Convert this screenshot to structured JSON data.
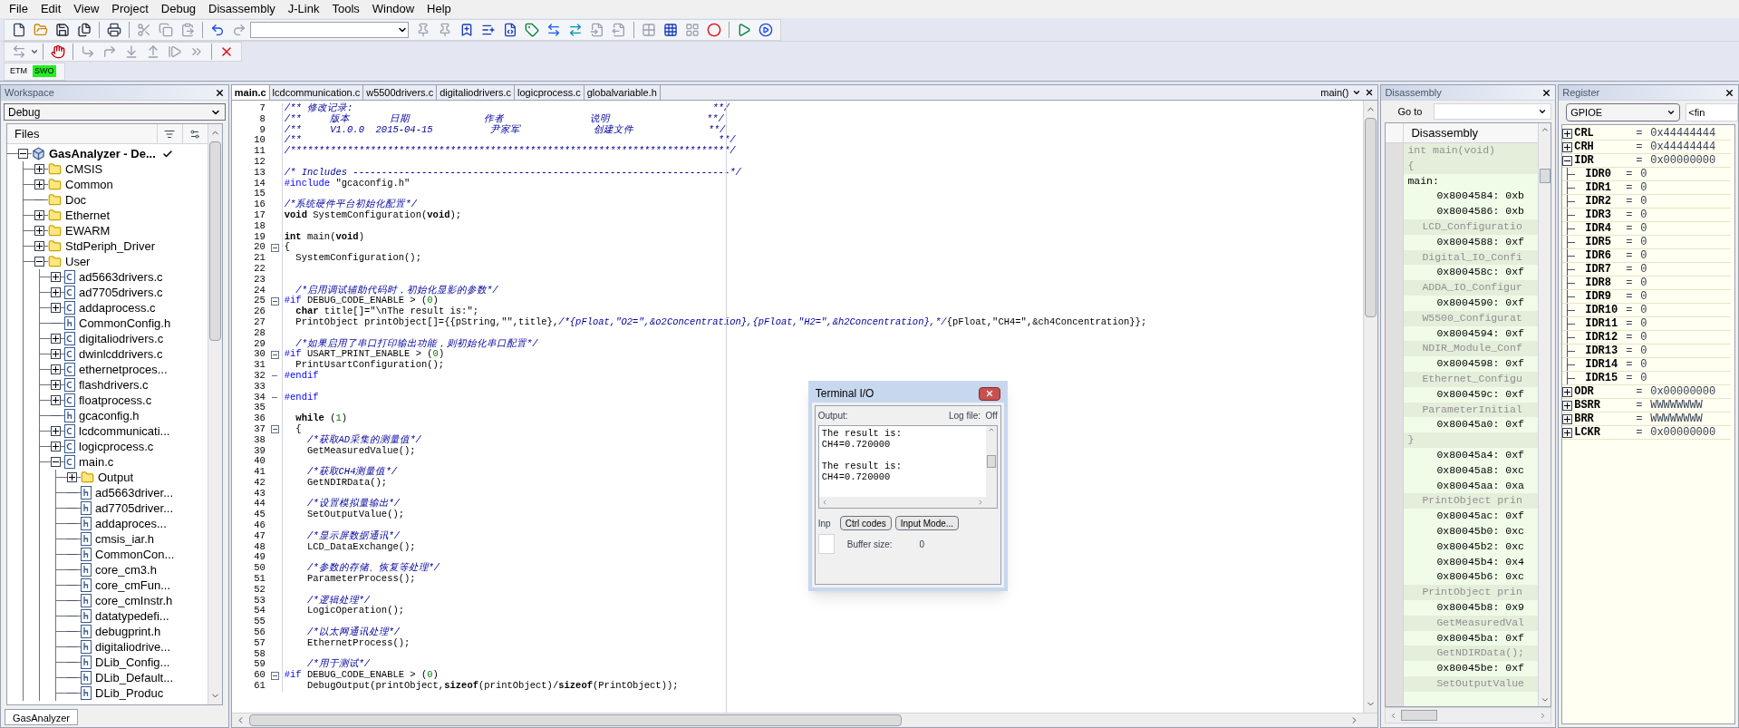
{
  "menu": [
    {
      "label": "File"
    },
    {
      "label": "Edit"
    },
    {
      "label": "View"
    },
    {
      "label": "Project"
    },
    {
      "label": "Debug"
    },
    {
      "label": "Disassembly"
    },
    {
      "label": "J-Link"
    },
    {
      "label": "Tools"
    },
    {
      "label": "Window"
    },
    {
      "label": "Help"
    }
  ],
  "toolbars": {
    "main": [
      {
        "disabled": false
      },
      {
        "disabled": false
      },
      {
        "disabled": false
      },
      {
        "disabled": false
      },
      {
        "disabled": false
      },
      {
        "disabled": true
      },
      {
        "disabled": true
      },
      {
        "disabled": true
      },
      {
        "disabled": false
      },
      {
        "disabled": true
      },
      {
        "disabled": true
      },
      {
        "disabled": true
      },
      {
        "disabled": false
      },
      {
        "disabled": false
      },
      {
        "disabled": false
      },
      {
        "disabled": false
      },
      {
        "disabled": false
      },
      {
        "disabled": false
      },
      {
        "disabled": true
      },
      {
        "disabled": true
      },
      {
        "disabled": true
      },
      {
        "disabled": false
      },
      {
        "disabled": true
      },
      {
        "disabled": false
      },
      {
        "disabled": false
      },
      {
        "disabled": false
      }
    ],
    "debug": [
      {
        "disabled": true
      },
      {
        "disabled": false
      },
      {
        "disabled": true
      },
      {
        "disabled": true
      },
      {
        "disabled": true
      },
      {
        "disabled": true
      },
      {
        "disabled": true
      },
      {
        "disabled": true
      },
      {
        "disabled": false
      }
    ],
    "trace": [
      {
        "label": "ETM",
        "on": false
      },
      {
        "label": "SWO",
        "on": true
      }
    ]
  },
  "workspace": {
    "title": "Workspace",
    "config": "Debug",
    "files_header": "Files",
    "bottom_tab": "GasAnalyzer",
    "tree": [
      {
        "label": "GasAnalyzer - De...",
        "kind": "project",
        "expanded": true,
        "checked": true,
        "children": [
          {
            "label": "CMSIS",
            "kind": "folder",
            "expanded": false
          },
          {
            "label": "Common",
            "kind": "folder",
            "expanded": false
          },
          {
            "label": "Doc",
            "kind": "folder"
          },
          {
            "label": "Ethernet",
            "kind": "folder",
            "expanded": false
          },
          {
            "label": "EWARM",
            "kind": "folder",
            "expanded": false
          },
          {
            "label": "StdPeriph_Driver",
            "kind": "folder",
            "expanded": false
          },
          {
            "label": "User",
            "kind": "folder",
            "expanded": true,
            "children": [
              {
                "label": "ad5663drivers.c",
                "kind": "c",
                "expanded": false
              },
              {
                "label": "ad7705drivers.c",
                "kind": "c",
                "expanded": false
              },
              {
                "label": "addaprocess.c",
                "kind": "c",
                "expanded": false
              },
              {
                "label": "CommonConfig.h",
                "kind": "h"
              },
              {
                "label": "digitaliodrivers.c",
                "kind": "c",
                "expanded": false
              },
              {
                "label": "dwinlcddrivers.c",
                "kind": "c",
                "expanded": false
              },
              {
                "label": "ethernetproces...",
                "kind": "c",
                "expanded": false
              },
              {
                "label": "flashdrivers.c",
                "kind": "c",
                "expanded": false
              },
              {
                "label": "floatprocess.c",
                "kind": "c",
                "expanded": false
              },
              {
                "label": "gcaconfig.h",
                "kind": "h"
              },
              {
                "label": "lcdcommunicati...",
                "kind": "c",
                "expanded": false
              },
              {
                "label": "logicprocess.c",
                "kind": "c",
                "expanded": false
              },
              {
                "label": "main.c",
                "kind": "c",
                "expanded": true,
                "children": [
                  {
                    "label": "Output",
                    "kind": "folder",
                    "expanded": false
                  },
                  {
                    "label": "ad5663driver...",
                    "kind": "h"
                  },
                  {
                    "label": "ad7705driver...",
                    "kind": "h"
                  },
                  {
                    "label": "addaproces...",
                    "kind": "h"
                  },
                  {
                    "label": "cmsis_iar.h",
                    "kind": "h"
                  },
                  {
                    "label": "CommonCon...",
                    "kind": "h"
                  },
                  {
                    "label": "core_cm3.h",
                    "kind": "h"
                  },
                  {
                    "label": "core_cmFun...",
                    "kind": "h"
                  },
                  {
                    "label": "core_cmInstr.h",
                    "kind": "h"
                  },
                  {
                    "label": "datatypedefi...",
                    "kind": "h"
                  },
                  {
                    "label": "debugprint.h",
                    "kind": "h"
                  },
                  {
                    "label": "digitaliodrive...",
                    "kind": "h"
                  },
                  {
                    "label": "DLib_Config...",
                    "kind": "h"
                  },
                  {
                    "label": "DLib_Default...",
                    "kind": "h"
                  },
                  {
                    "label": "DLib_Produc",
                    "kind": "h"
                  }
                ]
              }
            ]
          }
        ]
      }
    ]
  },
  "editor": {
    "tabs": [
      {
        "label": "main.c",
        "selected": true
      },
      {
        "label": "lcdcommunication.c",
        "selected": false
      },
      {
        "label": "w5500drivers.c",
        "selected": false
      },
      {
        "label": "digitaliodrivers.c",
        "selected": false
      },
      {
        "label": "logicprocess.c",
        "selected": false
      },
      {
        "label": "globalvariable.h",
        "selected": false
      }
    ],
    "function": "main()",
    "lines": [
      {
        "n": "7",
        "segs": [
          {
            "kind": "comment",
            "text": "/** 修改记录:                                                               **/"
          }
        ]
      },
      {
        "n": "8",
        "segs": [
          {
            "kind": "comment",
            "text": "/**     版本       日期             作者               说明                 **/"
          }
        ]
      },
      {
        "n": "9",
        "segs": [
          {
            "kind": "comment",
            "text": "/**     V1.0.0  2015-04-15          尹家军             创建文件             **/"
          }
        ]
      },
      {
        "n": "10",
        "segs": [
          {
            "kind": "comment",
            "text": "/**                                                                         **/"
          }
        ]
      },
      {
        "n": "11",
        "segs": [
          {
            "kind": "comment",
            "text": "/*****************************************************************************/"
          }
        ]
      },
      {
        "n": "12"
      },
      {
        "n": "13",
        "segs": [
          {
            "kind": "comment",
            "text": "/* Includes ------------------------------------------------------------------*/"
          }
        ]
      },
      {
        "n": "14",
        "segs": [
          {
            "kind": "pre",
            "text": "#include "
          },
          {
            "kind": "code",
            "text": "\"gcaconfig.h\""
          }
        ]
      },
      {
        "n": "15"
      },
      {
        "n": "16",
        "segs": [
          {
            "kind": "comment",
            "text": "/*系统硬件平台初始化配置*/"
          }
        ]
      },
      {
        "n": "17",
        "segs": [
          {
            "kind": "code",
            "text": "**void** SystemConfiguration(**void**);"
          }
        ]
      },
      {
        "n": "18"
      },
      {
        "n": "19",
        "segs": [
          {
            "kind": "code",
            "text": "**int** main(**void**)"
          }
        ]
      },
      {
        "n": "20",
        "collapsible": true,
        "segs": [
          {
            "kind": "code",
            "text": "{"
          }
        ]
      },
      {
        "n": "21",
        "segs": [
          {
            "kind": "code",
            "text": "  SystemConfiguration();"
          }
        ]
      },
      {
        "n": "22"
      },
      {
        "n": "23"
      },
      {
        "n": "24",
        "segs": [
          {
            "kind": "comment",
            "text": "  /*启用调试辅助代码时，初始化显影的参数*/"
          }
        ]
      },
      {
        "n": "25",
        "collapsible": true,
        "segs": [
          {
            "kind": "pre",
            "text": "#if"
          },
          {
            "kind": "code",
            "text": " DEBUG_CODE_ENABLE > ("
          },
          {
            "kind": "number",
            "text": "0"
          },
          {
            "kind": "code",
            "text": ")"
          }
        ]
      },
      {
        "n": "26",
        "segs": [
          {
            "kind": "code",
            "text": "  **char** title[]=\"\\nThe result is:\";"
          }
        ]
      },
      {
        "n": "27",
        "segs": [
          {
            "kind": "code",
            "text": "  PrintObject printObject[]={{pString,\"\",title},"
          },
          {
            "kind": "comment",
            "text": "/*{pFloat,\"O2=\",&o2Concentration},{pFloat,\"H2=\",&h2Concentration},*/"
          },
          {
            "kind": "code",
            "text": "{pFloat,\"CH4=\",&ch4Concentration}};"
          }
        ]
      },
      {
        "n": "28"
      },
      {
        "n": "29",
        "segs": [
          {
            "kind": "comment",
            "text": "  /*如果启用了串口打印输出功能，则初始化串口配置*/"
          }
        ]
      },
      {
        "n": "30",
        "collapsible": true,
        "segs": [
          {
            "kind": "pre",
            "text": "#if"
          },
          {
            "kind": "code",
            "text": " USART_PRINT_ENABLE > ("
          },
          {
            "kind": "number",
            "text": "0"
          },
          {
            "kind": "code",
            "text": ")"
          }
        ]
      },
      {
        "n": "31",
        "segs": [
          {
            "kind": "code",
            "text": "  PrintUsartConfiguration();"
          }
        ]
      },
      {
        "n": "32",
        "block_end": true,
        "segs": [
          {
            "kind": "pre",
            "text": "#endif"
          }
        ]
      },
      {
        "n": "33"
      },
      {
        "n": "34",
        "block_end": true,
        "segs": [
          {
            "kind": "pre",
            "text": "#endif"
          }
        ]
      },
      {
        "n": "35"
      },
      {
        "n": "36",
        "segs": [
          {
            "kind": "code",
            "text": "  **while** ("
          },
          {
            "kind": "number",
            "text": "1"
          },
          {
            "kind": "code",
            "text": ")"
          }
        ]
      },
      {
        "n": "37",
        "collapsible": true,
        "segs": [
          {
            "kind": "code",
            "text": "  {"
          }
        ]
      },
      {
        "n": "38",
        "segs": [
          {
            "kind": "comment",
            "text": "    /*获取AD采集的测量值*/"
          }
        ]
      },
      {
        "n": "39",
        "segs": [
          {
            "kind": "code",
            "text": "    GetMeasuredValue();"
          }
        ]
      },
      {
        "n": "40"
      },
      {
        "n": "41",
        "segs": [
          {
            "kind": "comment",
            "text": "    /*获取CH4测量值*/"
          }
        ]
      },
      {
        "n": "42",
        "segs": [
          {
            "kind": "code",
            "text": "    GetNDIRData();"
          }
        ]
      },
      {
        "n": "43"
      },
      {
        "n": "44",
        "segs": [
          {
            "kind": "comment",
            "text": "    /*设置模拟量输出*/"
          }
        ]
      },
      {
        "n": "45",
        "segs": [
          {
            "kind": "code",
            "text": "    SetOutputValue();"
          }
        ]
      },
      {
        "n": "46"
      },
      {
        "n": "47",
        "segs": [
          {
            "kind": "comment",
            "text": "    /*显示屏数据通讯*/"
          }
        ]
      },
      {
        "n": "48",
        "segs": [
          {
            "kind": "code",
            "text": "    LCD_DataExchange();"
          }
        ]
      },
      {
        "n": "49"
      },
      {
        "n": "50",
        "segs": [
          {
            "kind": "comment",
            "text": "    /*参数的存储、恢复等处理*/"
          }
        ]
      },
      {
        "n": "51",
        "segs": [
          {
            "kind": "code",
            "text": "    ParameterProcess();"
          }
        ]
      },
      {
        "n": "52"
      },
      {
        "n": "53",
        "segs": [
          {
            "kind": "comment",
            "text": "    /*逻辑处理*/"
          }
        ]
      },
      {
        "n": "54",
        "segs": [
          {
            "kind": "code",
            "text": "    LogicOperation();"
          }
        ]
      },
      {
        "n": "55"
      },
      {
        "n": "56",
        "segs": [
          {
            "kind": "comment",
            "text": "    /*以太网通讯处理*/"
          }
        ]
      },
      {
        "n": "57",
        "segs": [
          {
            "kind": "code",
            "text": "    EthernetProcess();"
          }
        ]
      },
      {
        "n": "58"
      },
      {
        "n": "59",
        "segs": [
          {
            "kind": "comment",
            "text": "    /*用于测试*/"
          }
        ]
      },
      {
        "n": "60",
        "collapsible": true,
        "segs": [
          {
            "kind": "pre",
            "text": "#if"
          },
          {
            "kind": "code",
            "text": " DEBUG_CODE_ENABLE > ("
          },
          {
            "kind": "number",
            "text": "0"
          },
          {
            "kind": "code",
            "text": ")"
          }
        ]
      },
      {
        "n": "61",
        "segs": [
          {
            "kind": "code",
            "text": "    DebugOutput(printObject,**sizeof**(printObject)/**sizeof**(PrintObject));"
          }
        ]
      }
    ]
  },
  "terminal": {
    "title": "Terminal I/O",
    "output_label": "Output:",
    "log_file": "Log file:  Off",
    "output": [
      {
        "lines": [
          "The result is:",
          "CH4=0.720000"
        ]
      },
      {
        "lines": [
          "The result is:",
          "CH4=0.720000"
        ]
      }
    ],
    "input_label": "Inp",
    "buttons": [
      "Ctrl codes",
      "Input Mode..."
    ],
    "buffer_label": "Buffer size:",
    "buffer_value": "0"
  },
  "disassembly": {
    "title": "Disassembly",
    "goto_label": "Go to",
    "header": "Disassembly",
    "rows": [
      {
        "kind": "decl",
        "text": "int main(void)"
      },
      {
        "kind": "decl",
        "text": "{"
      },
      {
        "kind": "label",
        "text": "main:"
      },
      {
        "kind": "addr",
        "text": "0x8004584: 0xb"
      },
      {
        "kind": "addr",
        "text": "0x8004586: 0xb"
      },
      {
        "kind": "source",
        "text": "LCD_Configuratio"
      },
      {
        "kind": "addr",
        "text": "0x8004588: 0xf"
      },
      {
        "kind": "source",
        "text": "Digital_IO_Confi"
      },
      {
        "kind": "addr",
        "text": "0x800458c: 0xf"
      },
      {
        "kind": "source",
        "text": "ADDA_IO_Configur"
      },
      {
        "kind": "addr",
        "text": "0x8004590: 0xf"
      },
      {
        "kind": "source",
        "text": "W5500_Configurat"
      },
      {
        "kind": "addr",
        "text": "0x8004594: 0xf"
      },
      {
        "kind": "source",
        "text": "NDIR_Module_Conf"
      },
      {
        "kind": "addr",
        "text": "0x8004598: 0xf"
      },
      {
        "kind": "source",
        "text": "Ethernet_Configu"
      },
      {
        "kind": "addr",
        "text": "0x800459c: 0xf"
      },
      {
        "kind": "source",
        "text": "ParameterInitial"
      },
      {
        "kind": "addr",
        "text": "0x80045a0: 0xf"
      },
      {
        "kind": "decl",
        "text": "}"
      },
      {
        "kind": "addr",
        "text": "0x80045a4: 0xf"
      },
      {
        "kind": "addr",
        "text": "0x80045a8: 0xc"
      },
      {
        "kind": "addr",
        "text": "0x80045aa: 0xa"
      },
      {
        "kind": "source",
        "text": "PrintObject prin"
      },
      {
        "kind": "addr",
        "text": "0x80045ac: 0xf"
      },
      {
        "kind": "addr",
        "text": "0x80045b0: 0xc"
      },
      {
        "kind": "addr",
        "text": "0x80045b2: 0xc"
      },
      {
        "kind": "addr",
        "text": "0x80045b4: 0x4"
      },
      {
        "kind": "addr",
        "text": "0x80045b6: 0xc"
      },
      {
        "kind": "source",
        "text": "PrintObject prin"
      },
      {
        "kind": "addr",
        "text": "0x80045b8: 0x9"
      },
      {
        "kind": "call",
        "text": "GetMeasuredVal"
      },
      {
        "kind": "addr",
        "text": "0x80045ba: 0xf"
      },
      {
        "kind": "call",
        "text": "GetNDIRData();"
      },
      {
        "kind": "addr",
        "text": "0x80045be: 0xf"
      },
      {
        "kind": "call",
        "text": "SetOutputValue"
      }
    ]
  },
  "register": {
    "title": "Register",
    "group": "GPIOE",
    "find": "<fin",
    "rows": [
      {
        "name": "CRL",
        "eq": "=",
        "value": "0x44444444",
        "expanded": false
      },
      {
        "name": "CRH",
        "eq": "=",
        "value": "0x44444444",
        "expanded": false
      },
      {
        "name": "IDR",
        "eq": "=",
        "value": "0x00000000",
        "expanded": true,
        "children": [
          {
            "name": "IDR0",
            "eq": "=",
            "value": "0"
          },
          {
            "name": "IDR1",
            "eq": "=",
            "value": "0"
          },
          {
            "name": "IDR2",
            "eq": "=",
            "value": "0"
          },
          {
            "name": "IDR3",
            "eq": "=",
            "value": "0"
          },
          {
            "name": "IDR4",
            "eq": "=",
            "value": "0"
          },
          {
            "name": "IDR5",
            "eq": "=",
            "value": "0"
          },
          {
            "name": "IDR6",
            "eq": "=",
            "value": "0"
          },
          {
            "name": "IDR7",
            "eq": "=",
            "value": "0"
          },
          {
            "name": "IDR8",
            "eq": "=",
            "value": "0"
          },
          {
            "name": "IDR9",
            "eq": "=",
            "value": "0"
          },
          {
            "name": "IDR10",
            "eq": "=",
            "value": "0"
          },
          {
            "name": "IDR11",
            "eq": "=",
            "value": "0"
          },
          {
            "name": "IDR12",
            "eq": "=",
            "value": "0"
          },
          {
            "name": "IDR13",
            "eq": "=",
            "value": "0"
          },
          {
            "name": "IDR14",
            "eq": "=",
            "value": "0"
          },
          {
            "name": "IDR15",
            "eq": "=",
            "value": "0"
          }
        ]
      },
      {
        "name": "ODR",
        "eq": "=",
        "value": "0x00000000",
        "expanded": false
      },
      {
        "name": "BSRR",
        "eq": "=",
        "value": "WWWWWWWW",
        "expanded": false
      },
      {
        "name": "BRR",
        "eq": "=",
        "value": "WWWWWWWW",
        "expanded": false
      },
      {
        "name": "LCKR",
        "eq": "=",
        "value": "0x00000000",
        "expanded": false
      }
    ]
  }
}
